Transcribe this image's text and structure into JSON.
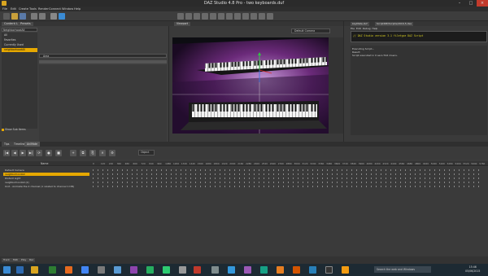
{
  "window": {
    "title": "DAZ Studio 4.8 Pro - two keyboards.duf"
  },
  "menu": [
    "File",
    "Edit",
    "Create",
    "Tools",
    "Render",
    "Connect",
    "Window",
    "Help"
  ],
  "left_panel": {
    "tabs": [
      "Content Library",
      "Presets"
    ],
    "filter_value": "NeighborhoodAll",
    "categories": [
      "All",
      "Favorites",
      "Currently Used",
      "neighborhoodAll"
    ],
    "selected_category": 3,
    "search_value": "Area",
    "show_sub_items_label": "Show Sub Items"
  },
  "viewport": {
    "tab": "Viewport",
    "camera": "Default Camera"
  },
  "script_panel": {
    "tabs": [
      "keyMate.duf",
      "ScriptIDE/Scripts/2016-5.dsa"
    ],
    "menu": [
      "File",
      "Edit",
      "Debug",
      "Help"
    ],
    "code": "// DAZ Studio version 3.1  filetype DAZ Script",
    "log_lines": [
      "Executing Script...",
      "Result:",
      "Script executed in 0 secs 594 msecs."
    ]
  },
  "bottom": {
    "tabs": [
      "Tips",
      "Timeline",
      "AniMate"
    ],
    "active_tab": 2,
    "object_label": "Object",
    "name_header": "Name",
    "ticks": [
      "0",
      "120",
      "240",
      "360",
      "480",
      "600",
      "720",
      "840",
      "960",
      "1080",
      "1200",
      "1320",
      "1440",
      "1560",
      "1680",
      "1800",
      "1920",
      "2040",
      "2160",
      "2280",
      "2400",
      "2520",
      "2640",
      "2760",
      "2880",
      "3000",
      "3120",
      "3240",
      "3360",
      "3480",
      "3600",
      "3720",
      "3840",
      "3960",
      "4080",
      "4200",
      "4320",
      "4440",
      "4560",
      "4680",
      "4800",
      "4920",
      "5040",
      "5160",
      "5280",
      "5400",
      "5520",
      "5640",
      "5760"
    ],
    "rows": [
      {
        "name": "Default Camera"
      },
      {
        "name": "neighborhoodAll",
        "selected": true
      },
      {
        "name": "Distant Light"
      },
      {
        "name": "neighborhoodAll (2)"
      },
      {
        "name": "Unit - Animate the 2 channel (1 related to channel 1 DB)"
      }
    ],
    "bottom_tabs": [
      "Track",
      "Midi",
      "Play",
      "Rec"
    ]
  },
  "taskbar": {
    "search_placeholder": "Search the web and Windows",
    "time": "15:46",
    "date": "05/06/2015"
  },
  "colors": {
    "accent": "#e6a800",
    "panel": "#3a3a3a",
    "close": "#c23a2b"
  }
}
